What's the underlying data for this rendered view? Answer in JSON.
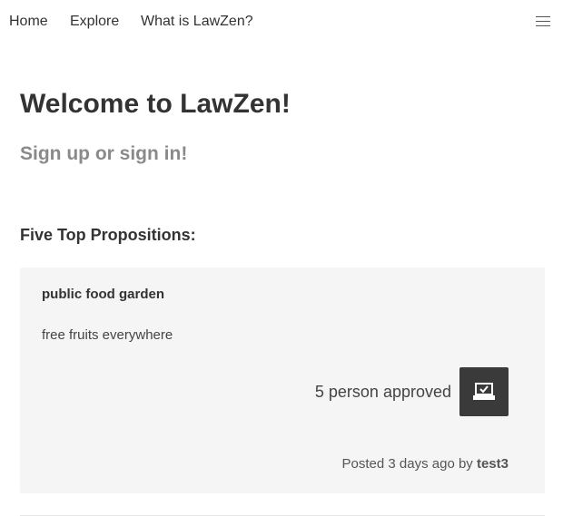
{
  "nav": {
    "home": "Home",
    "explore": "Explore",
    "what_is": "What is LawZen?",
    "menu_icon": "hamburger-menu-icon"
  },
  "header": {
    "title": "Welcome to LawZen!",
    "subtitle": "Sign up or sign in!"
  },
  "section": {
    "title": "Five Top Propositions:"
  },
  "propositions": [
    {
      "title": "public food garden",
      "description": "free fruits everywhere",
      "approved_text": "5 person approved",
      "approve_icon": "ballot-check-icon",
      "posted_prefix": "Posted 3 days ago by",
      "author": "test3"
    }
  ],
  "colors": {
    "card_background": "#f5f5f5",
    "approve_button": "#3a3a3a",
    "subtitle": "#8a8a8a"
  }
}
